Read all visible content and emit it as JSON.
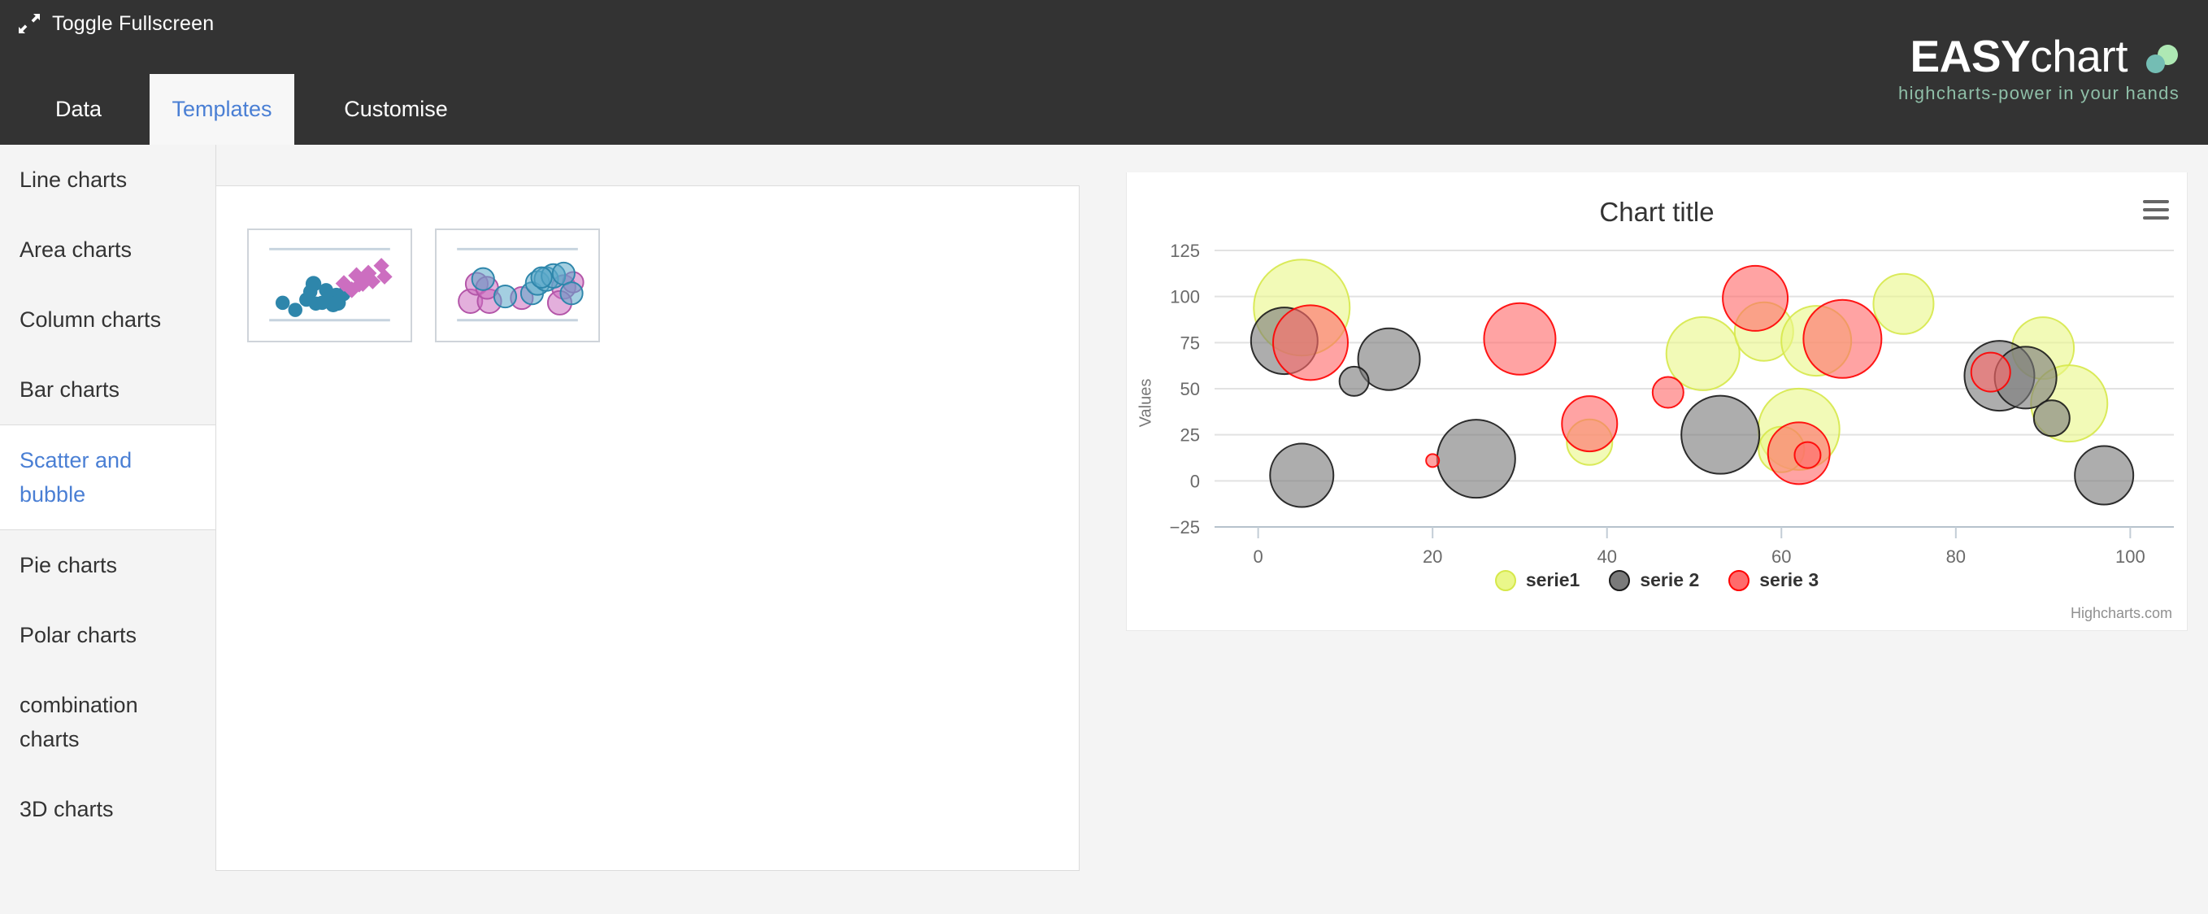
{
  "topbar": {
    "fullscreen_label": "Toggle Fullscreen",
    "fullscreen_icon": "expand-arrows-icon",
    "background": "#333333"
  },
  "logo": {
    "bold_part": "EASY",
    "light_part": "chart",
    "tagline": "highcharts-power in your hands",
    "dot_green": "#aee8b4",
    "dot_teal": "#74bdb4"
  },
  "tabs": [
    {
      "label": "Data",
      "active": false
    },
    {
      "label": "Templates",
      "active": true
    },
    {
      "label": "Customise",
      "active": false
    }
  ],
  "sidebar": {
    "items": [
      {
        "label": "Line charts",
        "active": false
      },
      {
        "label": "Area charts",
        "active": false
      },
      {
        "label": "Column charts",
        "active": false
      },
      {
        "label": "Bar charts",
        "active": false
      },
      {
        "label": "Scatter and bubble",
        "active": true
      },
      {
        "label": "Pie charts",
        "active": false
      },
      {
        "label": "Polar charts",
        "active": false
      },
      {
        "label": "combination charts",
        "active": false
      },
      {
        "label": "3D charts",
        "active": false
      }
    ],
    "active_color": "#4a7fd4"
  },
  "templates": {
    "thumbnails": [
      {
        "name": "scatter-template-thumbnail",
        "kind": "scatter"
      },
      {
        "name": "bubble-template-thumbnail",
        "kind": "bubble"
      }
    ],
    "thumb_colors": {
      "blue": "#2e86ab",
      "pink": "#cc6ec0",
      "grid": "#c6d3de"
    }
  },
  "chart": {
    "title": "Chart title",
    "menu_icon": "hamburger-menu-icon",
    "credits": "Highcharts.com"
  },
  "chart_data": {
    "type": "scatter",
    "title": "Chart title",
    "subtitle": "",
    "xlabel": "",
    "ylabel": "Values",
    "xlim": [
      -5,
      105
    ],
    "ylim": [
      -25,
      125
    ],
    "xticks": [
      0,
      20,
      40,
      60,
      80,
      100
    ],
    "yticks": [
      -25,
      0,
      25,
      50,
      75,
      100,
      125
    ],
    "grid": true,
    "legend_position": "bottom",
    "series": [
      {
        "name": "serie1",
        "color": "#eaf78a",
        "border": "#d6e84a",
        "points": [
          {
            "x": 5,
            "y": 94,
            "z": 59
          },
          {
            "x": 51,
            "y": 69,
            "z": 45
          },
          {
            "x": 58,
            "y": 81,
            "z": 36
          },
          {
            "x": 64,
            "y": 76,
            "z": 43
          },
          {
            "x": 74,
            "y": 96,
            "z": 37
          },
          {
            "x": 62,
            "y": 28,
            "z": 50
          },
          {
            "x": 60,
            "y": 17,
            "z": 28
          },
          {
            "x": 90,
            "y": 72,
            "z": 38
          },
          {
            "x": 93,
            "y": 42,
            "z": 47
          },
          {
            "x": 38,
            "y": 21,
            "z": 28
          }
        ]
      },
      {
        "name": "serie 2",
        "color": "#7a7a7a",
        "border": "#1a1a1a",
        "points": [
          {
            "x": 3,
            "y": 76,
            "z": 41
          },
          {
            "x": 15,
            "y": 66,
            "z": 38
          },
          {
            "x": 11,
            "y": 54,
            "z": 18
          },
          {
            "x": 5,
            "y": 3,
            "z": 39
          },
          {
            "x": 25,
            "y": 12,
            "z": 48
          },
          {
            "x": 53,
            "y": 25,
            "z": 48
          },
          {
            "x": 85,
            "y": 57,
            "z": 43
          },
          {
            "x": 88,
            "y": 56,
            "z": 38
          },
          {
            "x": 91,
            "y": 34,
            "z": 22
          },
          {
            "x": 97,
            "y": 3,
            "z": 36
          }
        ]
      },
      {
        "name": "serie 3",
        "color": "#ff6b6b",
        "border": "#ff0000",
        "points": [
          {
            "x": 6,
            "y": 75,
            "z": 46
          },
          {
            "x": 30,
            "y": 77,
            "z": 44
          },
          {
            "x": 38,
            "y": 31,
            "z": 34
          },
          {
            "x": 47,
            "y": 48,
            "z": 19
          },
          {
            "x": 57,
            "y": 99,
            "z": 40
          },
          {
            "x": 67,
            "y": 77,
            "z": 48
          },
          {
            "x": 62,
            "y": 15,
            "z": 38
          },
          {
            "x": 63,
            "y": 14,
            "z": 16
          },
          {
            "x": 20,
            "y": 11,
            "z": 8
          },
          {
            "x": 84,
            "y": 59,
            "z": 24
          }
        ]
      }
    ]
  }
}
